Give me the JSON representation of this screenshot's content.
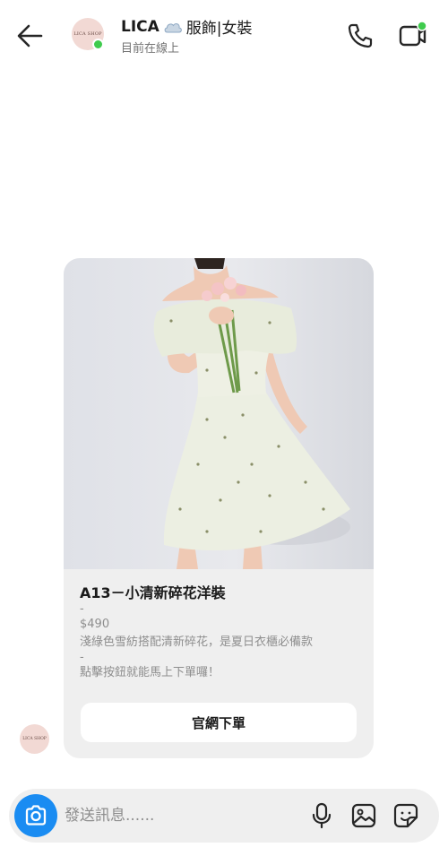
{
  "header": {
    "title_name": "LICA",
    "title_rest": "服飾|女裝",
    "status": "目前在線上",
    "avatar_text": "LICA SHOP",
    "online_color": "#3fcb4d"
  },
  "message": {
    "product_title": "A13－小清新碎花洋裝",
    "separator_1": "-",
    "price": "$490",
    "description": "淺綠色雪紡搭配清新碎花，是夏日衣櫃必備款",
    "separator_2": "-",
    "call_to_action": "點擊按鈕就能馬上下單囉！",
    "button_label": "官網下單"
  },
  "composer": {
    "placeholder": "發送訊息......",
    "accent_color": "#1a8cf2"
  },
  "icons": {
    "back": "arrow-left-icon",
    "call": "phone-icon",
    "video": "video-camera-icon",
    "camera": "camera-icon",
    "mic": "microphone-icon",
    "gallery": "image-icon",
    "sticker": "sticker-icon"
  }
}
